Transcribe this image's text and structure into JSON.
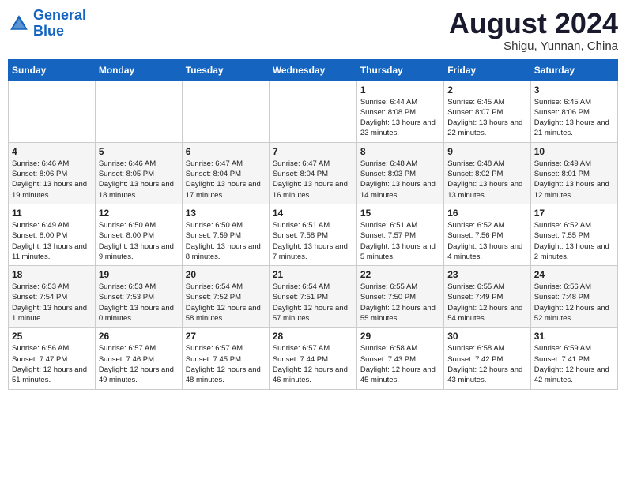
{
  "logo": {
    "line1": "General",
    "line2": "Blue"
  },
  "title": "August 2024",
  "subtitle": "Shigu, Yunnan, China",
  "days_of_week": [
    "Sunday",
    "Monday",
    "Tuesday",
    "Wednesday",
    "Thursday",
    "Friday",
    "Saturday"
  ],
  "weeks": [
    [
      {
        "day": "",
        "info": ""
      },
      {
        "day": "",
        "info": ""
      },
      {
        "day": "",
        "info": ""
      },
      {
        "day": "",
        "info": ""
      },
      {
        "day": "1",
        "info": "Sunrise: 6:44 AM\nSunset: 8:08 PM\nDaylight: 13 hours and 23 minutes."
      },
      {
        "day": "2",
        "info": "Sunrise: 6:45 AM\nSunset: 8:07 PM\nDaylight: 13 hours and 22 minutes."
      },
      {
        "day": "3",
        "info": "Sunrise: 6:45 AM\nSunset: 8:06 PM\nDaylight: 13 hours and 21 minutes."
      }
    ],
    [
      {
        "day": "4",
        "info": "Sunrise: 6:46 AM\nSunset: 8:06 PM\nDaylight: 13 hours and 19 minutes."
      },
      {
        "day": "5",
        "info": "Sunrise: 6:46 AM\nSunset: 8:05 PM\nDaylight: 13 hours and 18 minutes."
      },
      {
        "day": "6",
        "info": "Sunrise: 6:47 AM\nSunset: 8:04 PM\nDaylight: 13 hours and 17 minutes."
      },
      {
        "day": "7",
        "info": "Sunrise: 6:47 AM\nSunset: 8:04 PM\nDaylight: 13 hours and 16 minutes."
      },
      {
        "day": "8",
        "info": "Sunrise: 6:48 AM\nSunset: 8:03 PM\nDaylight: 13 hours and 14 minutes."
      },
      {
        "day": "9",
        "info": "Sunrise: 6:48 AM\nSunset: 8:02 PM\nDaylight: 13 hours and 13 minutes."
      },
      {
        "day": "10",
        "info": "Sunrise: 6:49 AM\nSunset: 8:01 PM\nDaylight: 13 hours and 12 minutes."
      }
    ],
    [
      {
        "day": "11",
        "info": "Sunrise: 6:49 AM\nSunset: 8:00 PM\nDaylight: 13 hours and 11 minutes."
      },
      {
        "day": "12",
        "info": "Sunrise: 6:50 AM\nSunset: 8:00 PM\nDaylight: 13 hours and 9 minutes."
      },
      {
        "day": "13",
        "info": "Sunrise: 6:50 AM\nSunset: 7:59 PM\nDaylight: 13 hours and 8 minutes."
      },
      {
        "day": "14",
        "info": "Sunrise: 6:51 AM\nSunset: 7:58 PM\nDaylight: 13 hours and 7 minutes."
      },
      {
        "day": "15",
        "info": "Sunrise: 6:51 AM\nSunset: 7:57 PM\nDaylight: 13 hours and 5 minutes."
      },
      {
        "day": "16",
        "info": "Sunrise: 6:52 AM\nSunset: 7:56 PM\nDaylight: 13 hours and 4 minutes."
      },
      {
        "day": "17",
        "info": "Sunrise: 6:52 AM\nSunset: 7:55 PM\nDaylight: 13 hours and 2 minutes."
      }
    ],
    [
      {
        "day": "18",
        "info": "Sunrise: 6:53 AM\nSunset: 7:54 PM\nDaylight: 13 hours and 1 minute."
      },
      {
        "day": "19",
        "info": "Sunrise: 6:53 AM\nSunset: 7:53 PM\nDaylight: 13 hours and 0 minutes."
      },
      {
        "day": "20",
        "info": "Sunrise: 6:54 AM\nSunset: 7:52 PM\nDaylight: 12 hours and 58 minutes."
      },
      {
        "day": "21",
        "info": "Sunrise: 6:54 AM\nSunset: 7:51 PM\nDaylight: 12 hours and 57 minutes."
      },
      {
        "day": "22",
        "info": "Sunrise: 6:55 AM\nSunset: 7:50 PM\nDaylight: 12 hours and 55 minutes."
      },
      {
        "day": "23",
        "info": "Sunrise: 6:55 AM\nSunset: 7:49 PM\nDaylight: 12 hours and 54 minutes."
      },
      {
        "day": "24",
        "info": "Sunrise: 6:56 AM\nSunset: 7:48 PM\nDaylight: 12 hours and 52 minutes."
      }
    ],
    [
      {
        "day": "25",
        "info": "Sunrise: 6:56 AM\nSunset: 7:47 PM\nDaylight: 12 hours and 51 minutes."
      },
      {
        "day": "26",
        "info": "Sunrise: 6:57 AM\nSunset: 7:46 PM\nDaylight: 12 hours and 49 minutes."
      },
      {
        "day": "27",
        "info": "Sunrise: 6:57 AM\nSunset: 7:45 PM\nDaylight: 12 hours and 48 minutes."
      },
      {
        "day": "28",
        "info": "Sunrise: 6:57 AM\nSunset: 7:44 PM\nDaylight: 12 hours and 46 minutes."
      },
      {
        "day": "29",
        "info": "Sunrise: 6:58 AM\nSunset: 7:43 PM\nDaylight: 12 hours and 45 minutes."
      },
      {
        "day": "30",
        "info": "Sunrise: 6:58 AM\nSunset: 7:42 PM\nDaylight: 12 hours and 43 minutes."
      },
      {
        "day": "31",
        "info": "Sunrise: 6:59 AM\nSunset: 7:41 PM\nDaylight: 12 hours and 42 minutes."
      }
    ]
  ]
}
